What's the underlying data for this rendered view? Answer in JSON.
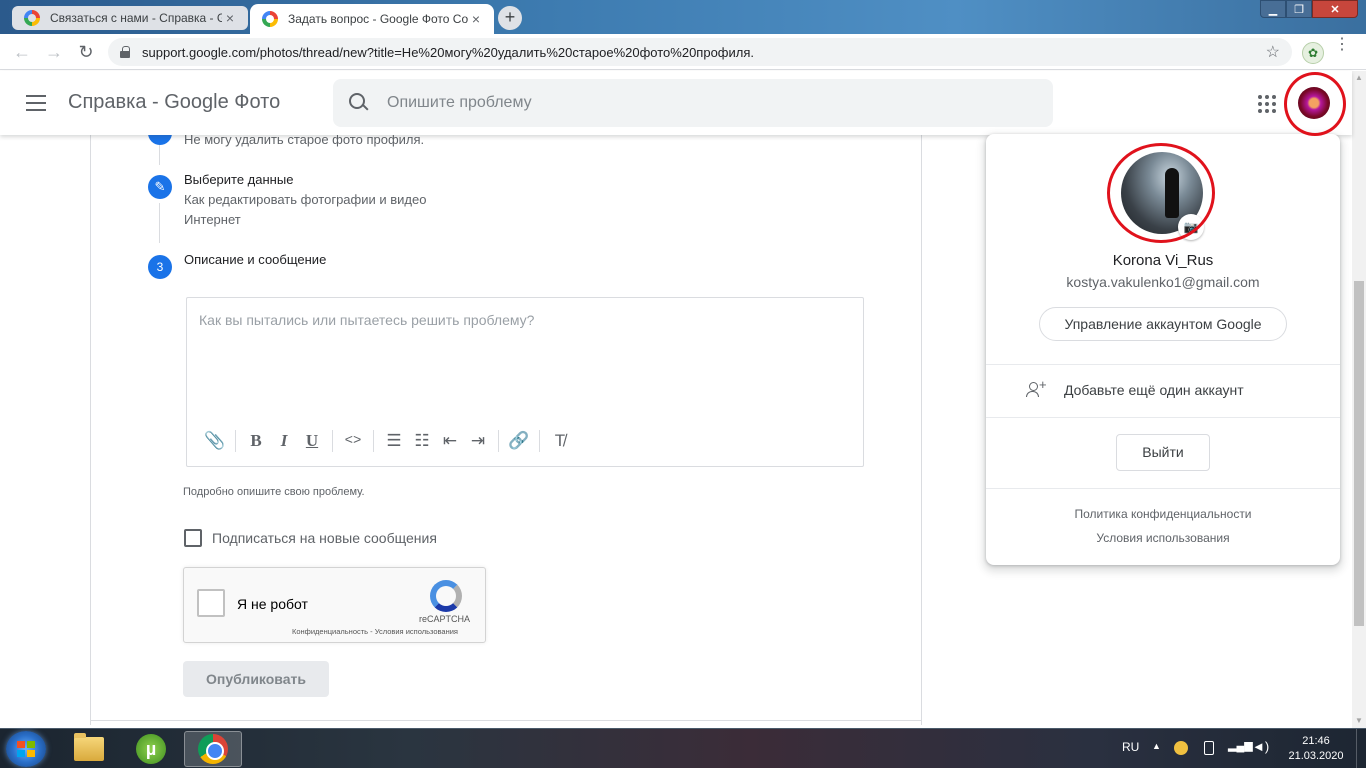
{
  "browser": {
    "tabs": [
      {
        "title": "Связаться с нами - Справка - Go",
        "active": false
      },
      {
        "title": "Задать вопрос - Google Фото Co",
        "active": true
      }
    ],
    "new_tab_label": "+",
    "window_controls": {
      "minimize": "▁",
      "maximize": "❐",
      "close": "✕"
    },
    "url": "support.google.com/photos/thread/new?title=Не%20могу%20удалить%20старое%20фото%20профиля.",
    "back_icon": "←",
    "forward_icon": "→",
    "reload_icon": "↻",
    "star_icon": "☆",
    "menu_icon": "⋮"
  },
  "header": {
    "title": "Справка - Google Фото",
    "search_placeholder": "Опишите проблему"
  },
  "steps": {
    "step1_value": "Не могу удалить старое фото профиля.",
    "step2_title": "Выберите данные",
    "step2_line1": "Как редактировать фотографии и видео",
    "step2_line2": "Интернет",
    "step3_number": "3",
    "step3_title": "Описание и сообщение"
  },
  "editor": {
    "placeholder": "Как вы пытались или пытаетесь решить проблему?",
    "tools": {
      "attach": "📎",
      "bold": "B",
      "italic": "I",
      "underline": "U",
      "code": "<>",
      "bullets": "☰",
      "numbered": "☷",
      "outdent": "⇤",
      "indent": "⇥",
      "link": "🔗",
      "clear": "T̸"
    }
  },
  "hint": "Подробно опишите свою проблему.",
  "subscribe_label": "Подписаться на новые сообщения",
  "captcha": {
    "label": "Я не робот",
    "brand": "reCAPTCHA",
    "terms": "Конфиденциальность - Условия использования"
  },
  "publish_label": "Опубликовать",
  "account_popup": {
    "name": "Korona Vi_Rus",
    "email": "kostya.vakulenko1@gmail.com",
    "manage_label": "Управление аккаунтом Google",
    "add_account_label": "Добавьте ещё один аккаунт",
    "signout_label": "Выйти",
    "privacy_label": "Политика конфиденциальности",
    "terms_label": "Условия использования",
    "camera_icon": "📷"
  },
  "taskbar": {
    "language": "RU",
    "tray_up": "▲",
    "time": "21:46",
    "date": "21.03.2020",
    "utorrent_letter": "µ"
  },
  "colors": {
    "accent_blue": "#1a73e8",
    "highlight_red": "#e0121c"
  }
}
